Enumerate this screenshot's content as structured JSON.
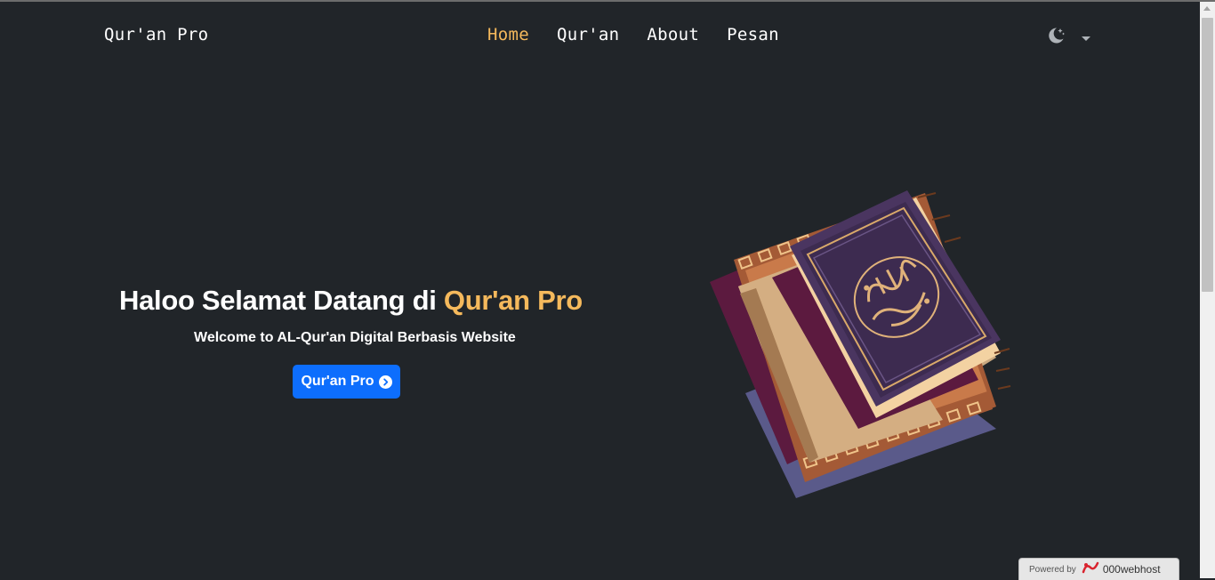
{
  "navbar": {
    "brand": "Qur'an Pro",
    "items": [
      {
        "label": "Home",
        "active": true
      },
      {
        "label": "Qur'an",
        "active": false
      },
      {
        "label": "About",
        "active": false
      },
      {
        "label": "Pesan",
        "active": false
      }
    ],
    "theme_icon": "moon-stars-icon"
  },
  "hero": {
    "title_prefix": "Haloo Selamat Datang di ",
    "title_accent": "Qur'an Pro",
    "subtitle": "Welcome to AL-Qur'an Digital Berbasis Website",
    "button_label": "Qur'an Pro",
    "button_icon": "chevron-circle-right-icon",
    "illustration": "quran-books-icon"
  },
  "footer_badge": {
    "powered_by": "Powered by",
    "host": "000webhost"
  },
  "colors": {
    "background": "#212529",
    "accent": "#f5b95c",
    "primary": "#0d6efd"
  }
}
